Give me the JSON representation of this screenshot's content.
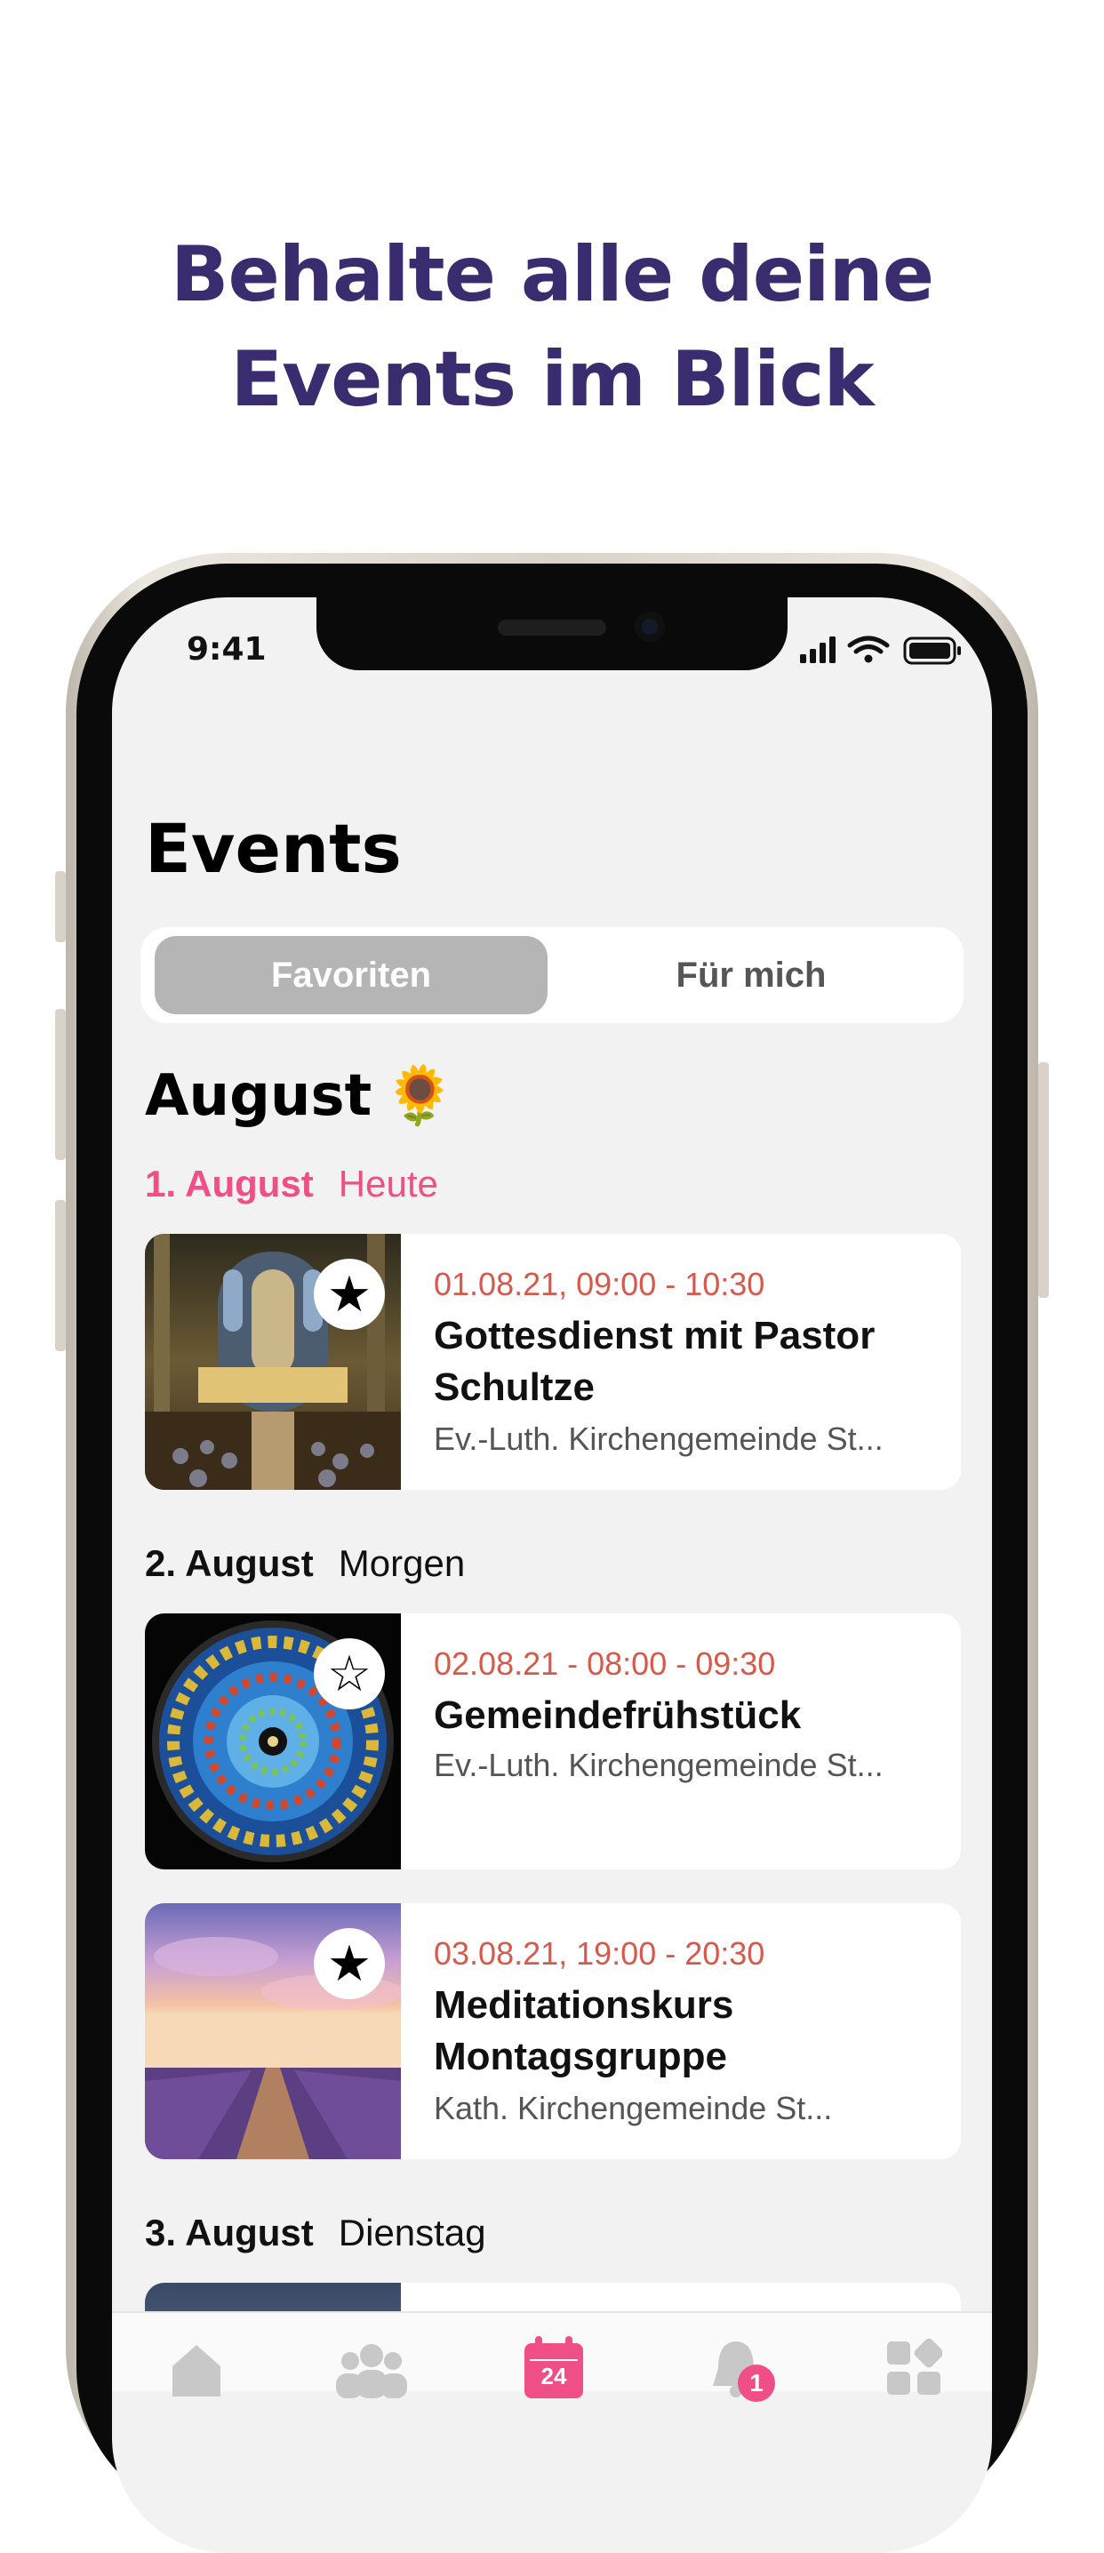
{
  "headline": {
    "line1": "Behalte alle deine",
    "line2": "Events im Blick"
  },
  "status_bar": {
    "time": "9:41"
  },
  "screen": {
    "title": "Events",
    "segments": {
      "active": "Favoriten",
      "inactive": "Für mich"
    },
    "month": {
      "label": "August",
      "emoji": "🌻"
    },
    "days": [
      {
        "date": "1. August",
        "relative": "Heute"
      },
      {
        "date": "2. August",
        "relative": "Morgen"
      },
      {
        "date": "3. August",
        "relative": "Dienstag"
      }
    ],
    "events": [
      {
        "when": "01.08.21, 09:00 - 10:30",
        "title": "Gottesdienst mit Pastor Schultze",
        "place": "Ev.-Luth. Kirchengemeinde St...",
        "favorite": true
      },
      {
        "when": "02.08.21 - 08:00 - 09:30",
        "title": "Gemeindefrühstück",
        "place": "Ev.-Luth. Kirchengemeinde St...",
        "favorite": false
      },
      {
        "when": "03.08.21, 19:00 - 20:30",
        "title": "Meditationskurs Montagsgruppe",
        "place": "Kath. Kirchengemeinde St...",
        "favorite": true
      }
    ]
  },
  "tabbar": {
    "calendar_day": "24",
    "notification_count": "1"
  },
  "colors": {
    "headline": "#3a2c6e",
    "today": "#ef4f86",
    "time": "#d65a4c",
    "segment_active": "#b5b5b5"
  },
  "icons": [
    "home-icon",
    "group-icon",
    "calendar-icon",
    "bell-icon",
    "apps-icon",
    "star-filled-icon",
    "star-outline-icon"
  ]
}
